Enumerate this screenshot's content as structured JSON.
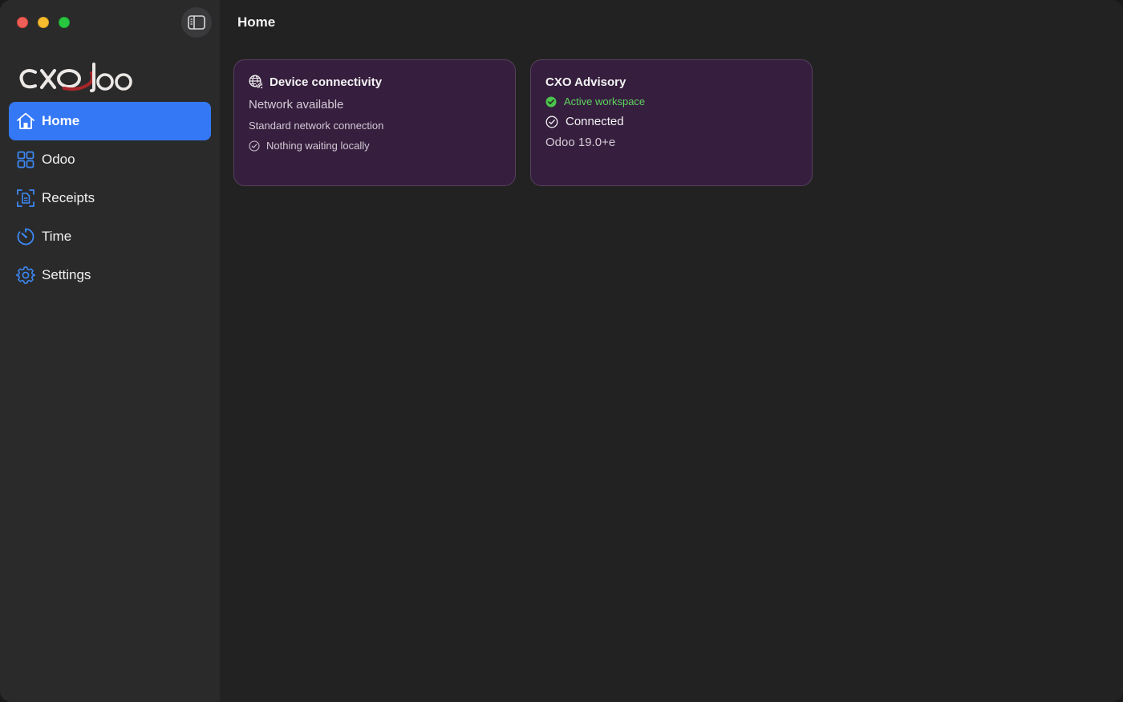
{
  "window": {
    "controls": [
      "close",
      "minimize",
      "maximize"
    ]
  },
  "sidebar": {
    "toggle_icon": "sidebar-toggle-icon",
    "logo_text": "CXOdoo",
    "items": [
      {
        "label": "Home",
        "icon": "house-icon",
        "active": true
      },
      {
        "label": "Odoo",
        "icon": "grid-icon",
        "active": false
      },
      {
        "label": "Receipts",
        "icon": "receipt-scan-icon",
        "active": false
      },
      {
        "label": "Time",
        "icon": "timer-icon",
        "active": false
      },
      {
        "label": "Settings",
        "icon": "gear-icon",
        "active": false
      }
    ]
  },
  "main": {
    "title": "Home",
    "cards": [
      {
        "title": "Device connectivity",
        "icon": "globe-network-icon",
        "status": "Network available",
        "detail": "Standard network connection",
        "queue": "Nothing waiting locally"
      },
      {
        "title": "CXO Advisory",
        "workspace_status": "Active workspace",
        "connection": "Connected",
        "version": "Odoo 19.0+e"
      }
    ]
  },
  "colors": {
    "accent": "#3478f6",
    "card_bg": "#361e3e",
    "success": "#5fd45f",
    "logo_red": "#a8262a"
  }
}
